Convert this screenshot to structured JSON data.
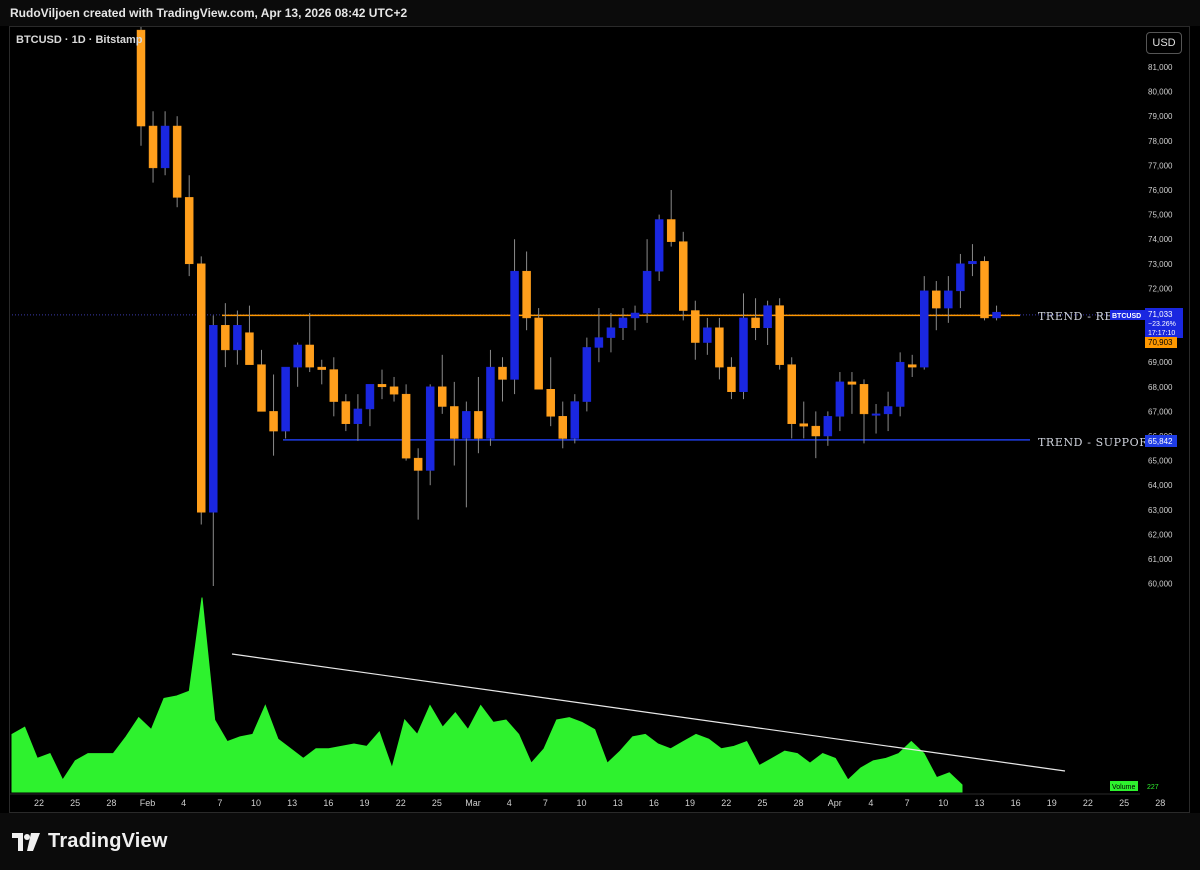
{
  "header": {
    "credit": "RudoViljoen created with TradingView.com, Apr 13, 2026 08:42 UTC+2"
  },
  "symbol": {
    "label": "BTCUSD · 1D · Bitstamp"
  },
  "currency_button": "USD",
  "footer": {
    "brand": "TradingView"
  },
  "colors": {
    "up": "#1a27e0",
    "down": "#ff9f1c",
    "resistance": "#ff9800",
    "support": "#1f3de6",
    "volume": "#2ef22e",
    "background": "#000000"
  },
  "annotations": {
    "resistance_label": "TREND - RESISTANCE",
    "support_label": "TREND - SUPPORT"
  },
  "price_tags": {
    "symbol": "BTCUSD",
    "last_price": "71,033",
    "change": "−23.26%",
    "countdown": "17:17:10",
    "resistance": "70,903",
    "support": "65,842"
  },
  "volume_tag": {
    "label": "Volume",
    "value": "227"
  },
  "chart_data": {
    "type": "candlestick",
    "title": "BTCUSD · 1D · Bitstamp",
    "ylim": [
      59000,
      82000
    ],
    "y_ticks": [
      60000,
      61000,
      62000,
      63000,
      64000,
      65000,
      66000,
      67000,
      68000,
      69000,
      70000,
      71000,
      72000,
      73000,
      74000,
      75000,
      76000,
      77000,
      78000,
      79000,
      80000,
      81000
    ],
    "x_tick_labels": [
      "22",
      "25",
      "28",
      "Feb",
      "4",
      "7",
      "10",
      "13",
      "16",
      "19",
      "22",
      "25",
      "Mar",
      "4",
      "7",
      "10",
      "13",
      "16",
      "19",
      "22",
      "25",
      "28",
      "Apr",
      "4",
      "7",
      "10",
      "13",
      "16",
      "19",
      "22",
      "25",
      "28"
    ],
    "resistance_level": 70903,
    "support_level": 65842,
    "candles": [
      {
        "date": "Jan 31",
        "open": 82500,
        "high": 83500,
        "low": 77800,
        "close": 78600
      },
      {
        "date": "Feb 1",
        "open": 78600,
        "high": 79200,
        "low": 76300,
        "close": 76900
      },
      {
        "date": "Feb 2",
        "open": 76900,
        "high": 79200,
        "low": 76600,
        "close": 78600
      },
      {
        "date": "Feb 3",
        "open": 78600,
        "high": 79000,
        "low": 75300,
        "close": 75700
      },
      {
        "date": "Feb 4",
        "open": 75700,
        "high": 76600,
        "low": 72500,
        "close": 73000
      },
      {
        "date": "Feb 5",
        "open": 73000,
        "high": 73300,
        "low": 62400,
        "close": 62900
      },
      {
        "date": "Feb 6",
        "open": 62900,
        "high": 70900,
        "low": 59900,
        "close": 70500
      },
      {
        "date": "Feb 7",
        "open": 70500,
        "high": 71400,
        "low": 68800,
        "close": 69500
      },
      {
        "date": "Feb 8",
        "open": 69500,
        "high": 71100,
        "low": 68900,
        "close": 70500
      },
      {
        "date": "Feb 9",
        "open": 70200,
        "high": 71300,
        "low": 69000,
        "close": 68900
      },
      {
        "date": "Feb 10",
        "open": 68900,
        "high": 69500,
        "low": 67400,
        "close": 67000
      },
      {
        "date": "Feb 11",
        "open": 67000,
        "high": 68500,
        "low": 65200,
        "close": 66200
      },
      {
        "date": "Feb 12",
        "open": 66200,
        "high": 68700,
        "low": 65900,
        "close": 68800
      },
      {
        "date": "Feb 13",
        "open": 68800,
        "high": 69800,
        "low": 68000,
        "close": 69700
      },
      {
        "date": "Feb 14",
        "open": 69700,
        "high": 71000,
        "low": 68600,
        "close": 68800
      },
      {
        "date": "Feb 15",
        "open": 68800,
        "high": 69100,
        "low": 68100,
        "close": 68700
      },
      {
        "date": "Feb 16",
        "open": 68700,
        "high": 69200,
        "low": 66800,
        "close": 67400
      },
      {
        "date": "Feb 17",
        "open": 67400,
        "high": 67700,
        "low": 66200,
        "close": 66500
      },
      {
        "date": "Feb 18",
        "open": 66500,
        "high": 67700,
        "low": 65800,
        "close": 67100
      },
      {
        "date": "Feb 19",
        "open": 67100,
        "high": 68100,
        "low": 66400,
        "close": 68100
      },
      {
        "date": "Feb 20",
        "open": 68100,
        "high": 68700,
        "low": 67500,
        "close": 68000
      },
      {
        "date": "Feb 21",
        "open": 68000,
        "high": 68400,
        "low": 67400,
        "close": 67700
      },
      {
        "date": "Feb 22",
        "open": 67700,
        "high": 68100,
        "low": 65000,
        "close": 65100
      },
      {
        "date": "Feb 23",
        "open": 65100,
        "high": 65500,
        "low": 62600,
        "close": 64600
      },
      {
        "date": "Feb 24",
        "open": 64600,
        "high": 68100,
        "low": 64000,
        "close": 68000
      },
      {
        "date": "Feb 25",
        "open": 68000,
        "high": 69300,
        "low": 66900,
        "close": 67200
      },
      {
        "date": "Feb 26",
        "open": 67200,
        "high": 68200,
        "low": 64800,
        "close": 65900
      },
      {
        "date": "Feb 27",
        "open": 65900,
        "high": 67400,
        "low": 63100,
        "close": 67000
      },
      {
        "date": "Feb 28",
        "open": 67000,
        "high": 68400,
        "low": 65300,
        "close": 65900
      },
      {
        "date": "Mar 1",
        "open": 65900,
        "high": 69500,
        "low": 65600,
        "close": 68800
      },
      {
        "date": "Mar 2",
        "open": 68800,
        "high": 69200,
        "low": 67400,
        "close": 68300
      },
      {
        "date": "Mar 3",
        "open": 68300,
        "high": 74000,
        "low": 67700,
        "close": 72700
      },
      {
        "date": "Mar 4",
        "open": 72700,
        "high": 73500,
        "low": 70300,
        "close": 70800
      },
      {
        "date": "Mar 5",
        "open": 70800,
        "high": 71200,
        "low": 67900,
        "close": 67900
      },
      {
        "date": "Mar 6",
        "open": 67900,
        "high": 69200,
        "low": 66400,
        "close": 66800
      },
      {
        "date": "Mar 7",
        "open": 66800,
        "high": 67400,
        "low": 65500,
        "close": 65900
      },
      {
        "date": "Mar 8",
        "open": 65900,
        "high": 67700,
        "low": 65700,
        "close": 67400
      },
      {
        "date": "Mar 9",
        "open": 67400,
        "high": 70000,
        "low": 67000,
        "close": 69600
      },
      {
        "date": "Mar 10",
        "open": 69600,
        "high": 71200,
        "low": 69000,
        "close": 70000
      },
      {
        "date": "Mar 11",
        "open": 70000,
        "high": 71000,
        "low": 69400,
        "close": 70400
      },
      {
        "date": "Mar 12",
        "open": 70400,
        "high": 71200,
        "low": 69900,
        "close": 70800
      },
      {
        "date": "Mar 13",
        "open": 70800,
        "high": 71300,
        "low": 70300,
        "close": 71000
      },
      {
        "date": "Mar 14",
        "open": 71000,
        "high": 74000,
        "low": 70600,
        "close": 72700
      },
      {
        "date": "Mar 15",
        "open": 72700,
        "high": 75000,
        "low": 72300,
        "close": 74800
      },
      {
        "date": "Mar 16",
        "open": 74800,
        "high": 76000,
        "low": 73700,
        "close": 73900
      },
      {
        "date": "Mar 17",
        "open": 73900,
        "high": 74300,
        "low": 70700,
        "close": 71100
      },
      {
        "date": "Mar 18",
        "open": 71100,
        "high": 71500,
        "low": 69100,
        "close": 69800
      },
      {
        "date": "Mar 19",
        "open": 69800,
        "high": 70800,
        "low": 69300,
        "close": 70400
      },
      {
        "date": "Mar 20",
        "open": 70400,
        "high": 70800,
        "low": 68300,
        "close": 68800
      },
      {
        "date": "Mar 21",
        "open": 68800,
        "high": 69200,
        "low": 67500,
        "close": 67800
      },
      {
        "date": "Mar 22",
        "open": 67800,
        "high": 71800,
        "low": 67500,
        "close": 70800
      },
      {
        "date": "Mar 23",
        "open": 70800,
        "high": 71600,
        "low": 69900,
        "close": 70400
      },
      {
        "date": "Mar 24",
        "open": 70400,
        "high": 71500,
        "low": 69700,
        "close": 71300
      },
      {
        "date": "Mar 25",
        "open": 71300,
        "high": 71600,
        "low": 68700,
        "close": 68900
      },
      {
        "date": "Mar 26",
        "open": 68900,
        "high": 69200,
        "low": 65900,
        "close": 66500
      },
      {
        "date": "Mar 27",
        "open": 66500,
        "high": 67400,
        "low": 65900,
        "close": 66400
      },
      {
        "date": "Mar 28",
        "open": 66400,
        "high": 67000,
        "low": 65100,
        "close": 66000
      },
      {
        "date": "Mar 29",
        "open": 66000,
        "high": 67000,
        "low": 65600,
        "close": 66800
      },
      {
        "date": "Mar 30",
        "open": 66800,
        "high": 68600,
        "low": 66200,
        "close": 68200
      },
      {
        "date": "Mar 31",
        "open": 68200,
        "high": 68600,
        "low": 66900,
        "close": 68100
      },
      {
        "date": "Apr 1",
        "open": 68100,
        "high": 68300,
        "low": 65700,
        "close": 66900
      },
      {
        "date": "Apr 2",
        "open": 66900,
        "high": 67300,
        "low": 66100,
        "close": 66900
      },
      {
        "date": "Apr 3",
        "open": 66900,
        "high": 67800,
        "low": 66200,
        "close": 67200
      },
      {
        "date": "Apr 4",
        "open": 67200,
        "high": 69400,
        "low": 66800,
        "close": 69000
      },
      {
        "date": "Apr 5",
        "open": 68900,
        "high": 69300,
        "low": 68400,
        "close": 68800
      },
      {
        "date": "Apr 6",
        "open": 68800,
        "high": 72500,
        "low": 68700,
        "close": 71900
      },
      {
        "date": "Apr 7",
        "open": 71900,
        "high": 72300,
        "low": 70300,
        "close": 71200
      },
      {
        "date": "Apr 8",
        "open": 71200,
        "high": 72500,
        "low": 70600,
        "close": 71900
      },
      {
        "date": "Apr 9",
        "open": 71900,
        "high": 73400,
        "low": 71200,
        "close": 73000
      },
      {
        "date": "Apr 10",
        "open": 73000,
        "high": 73800,
        "low": 72500,
        "close": 73100
      },
      {
        "date": "Apr 11",
        "open": 73100,
        "high": 73300,
        "low": 70700,
        "close": 70800
      },
      {
        "date": "Apr 12",
        "open": 70800,
        "high": 71300,
        "low": 70700,
        "close": 71033
      }
    ],
    "volume_series": {
      "name": "Volume",
      "values": [
        24,
        27,
        14,
        16,
        5,
        13,
        16,
        16,
        16,
        23,
        31,
        26,
        39,
        40,
        42,
        81,
        30,
        21,
        23,
        24,
        36,
        22,
        18,
        14,
        18,
        18,
        19,
        20,
        19,
        25,
        10,
        30,
        24,
        36,
        27,
        33,
        26,
        36,
        29,
        30,
        24,
        12,
        18,
        30,
        31,
        29,
        26,
        12,
        17,
        23,
        24,
        20,
        18,
        21,
        24,
        22,
        18,
        19,
        21,
        11,
        14,
        17,
        16,
        12,
        16,
        14,
        5,
        10,
        13,
        14,
        16,
        21,
        16,
        6,
        8,
        3
      ]
    }
  }
}
